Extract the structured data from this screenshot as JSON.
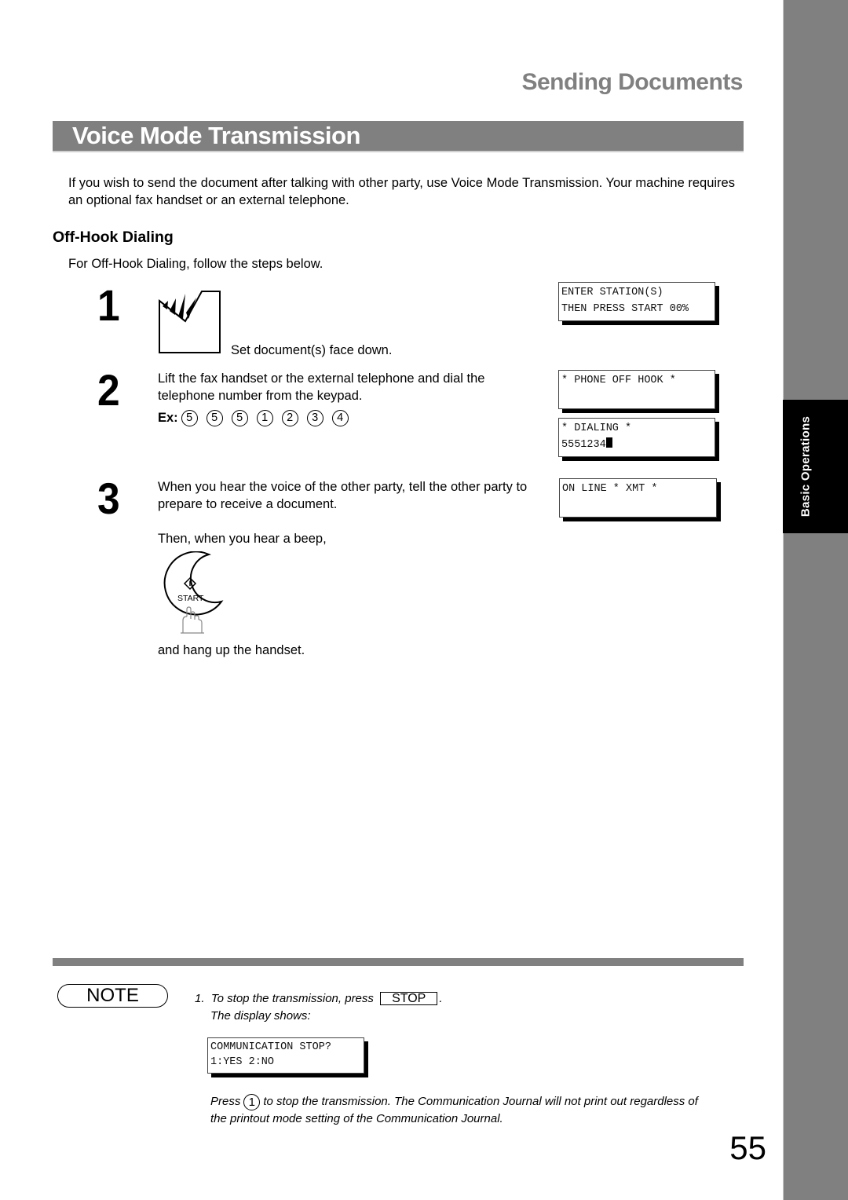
{
  "header": {
    "chapter_title": "Sending Documents",
    "section_title": "Voice Mode Transmission"
  },
  "side_tab": {
    "label": "Basic Operations"
  },
  "intro": "If you wish to send the document after talking with other party, use Voice Mode Transmission.  Your machine requires an optional fax handset or an external telephone.",
  "subsection": {
    "title": "Off-Hook Dialing",
    "lead": "For Off-Hook Dialing, follow the steps below."
  },
  "steps": [
    {
      "number": "1",
      "icon": "document-face-down-icon",
      "text": "Set document(s) face down.",
      "display": {
        "line1": "ENTER STATION(S)",
        "line2": "THEN PRESS START 00%"
      }
    },
    {
      "number": "2",
      "text": "Lift the fax handset or the external telephone and dial the telephone number from the keypad.",
      "example_label": "Ex:",
      "example_keys": [
        "5",
        "5",
        "5",
        "1",
        "2",
        "3",
        "4"
      ],
      "displays": [
        {
          "line1": "* PHONE OFF HOOK *",
          "line2": ""
        },
        {
          "line1": "* DIALING *",
          "line2": "5551234"
        }
      ]
    },
    {
      "number": "3",
      "text": "When you hear the voice of the other party, tell the other party to prepare to receive a document.",
      "then_text": "Then, when you hear a beep,",
      "button_label": "START",
      "after_text": "and hang up the handset.",
      "display": {
        "line1": "ON LINE * XMT *",
        "line2": ""
      }
    }
  ],
  "note": {
    "badge": "NOTE",
    "item_number": "1.",
    "line1_before": "To stop the transmission, press",
    "stop_key": "STOP",
    "line1_after": ".",
    "line2": "The display shows:",
    "display": {
      "line1": "COMMUNICATION STOP?",
      "line2": "1:YES 2:NO"
    },
    "press_before": "Press",
    "press_key": "1",
    "press_after": "to stop the transmission. The Communication Journal will not print out regardless of",
    "press_line2": "the printout mode setting of the Communication Journal."
  },
  "page_number": "55"
}
